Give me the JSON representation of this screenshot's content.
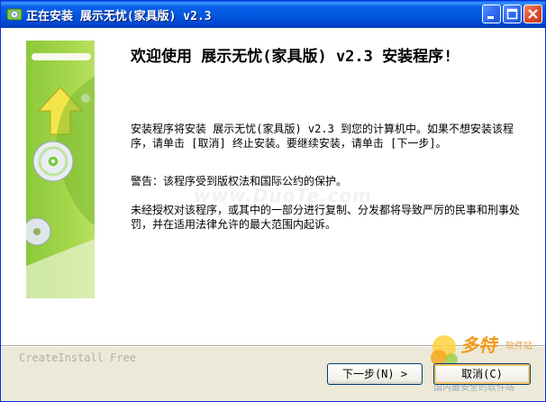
{
  "window": {
    "title": "正在安装 展示无忧(家具版) v2.3",
    "controls": {
      "minimize": "minimize",
      "maximize": "maximize",
      "close": "close"
    }
  },
  "content": {
    "heading": "欢迎使用 展示无忧(家具版) v2.3 安装程序!",
    "paragraphs": [
      "安装程序将安装 展示无忧(家具版) v2.3 到您的计算机中。如果不想安装该程序，请单击 [取消] 终止安装。要继续安装，请单击 [下一步]。",
      "警告：该程序受到版权法和国际公约的保护。",
      "未经授权对该程序，或其中的一部分进行复制、分发都将导致严厉的民事和刑事处罚，并在适用法律允许的最大范围内起诉。"
    ],
    "watermark": "www.DuoTe.com"
  },
  "footer": {
    "brand": "CreateInstall Free",
    "next_button": "下一步(N) >",
    "cancel_button": "取消(C)"
  },
  "corner_logo": {
    "name": "多特",
    "sub": "软件站",
    "url": "国内最安全的软件站"
  },
  "colors": {
    "titlebar": "#0356e0",
    "side_panel": "#a4d649",
    "logo_orange": "#f39a1b"
  }
}
